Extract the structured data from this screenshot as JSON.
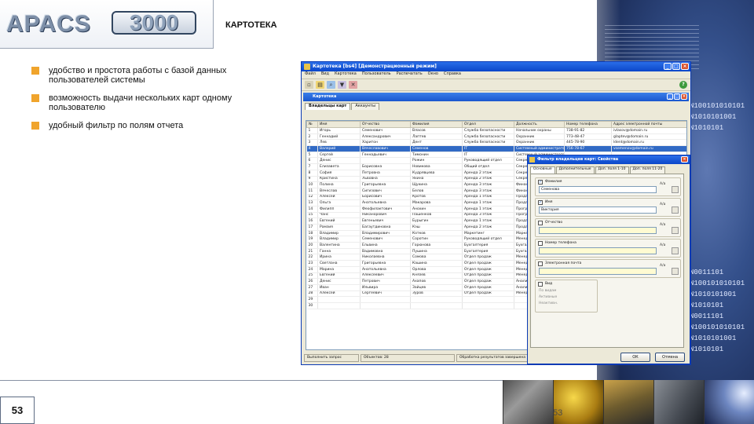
{
  "header": {
    "logo_text": "APACS",
    "logo_number": "3000",
    "page_title": "КАРТОТЕКА"
  },
  "bullets": [
    "удобство и простота работы с базой данных пользователей системы",
    "возможность выдачи нескольких карт одному пользователю",
    "удобный фильтр по полям отчета"
  ],
  "footer": {
    "page_number": "53",
    "page_number_small": "53"
  },
  "decor": {
    "code_top": "N100101010101\nN1010101001\nN1010101",
    "code_bottom": "N0011101\nN100101010101\nN1010101001\nN1010101\nN0011101\nN100101010101\nN1010101001\nN1010101"
  },
  "app": {
    "title": "Картотека [bs4] [Демонстрационный режим]",
    "menu": [
      "Файл",
      "Вид",
      "Картотека",
      "Пользователь",
      "Распечатать",
      "Окно",
      "Справка"
    ],
    "inner_title": "Картотека",
    "tabs": [
      "Владельцы карт",
      "Аккаунты"
    ],
    "columns": [
      "№",
      "Имя",
      "Отчество",
      "Фамилия",
      "Отдел",
      "Должность",
      "Номер телефона",
      "Адрес электронной почты"
    ],
    "rows": [
      [
        "1",
        "Игорь",
        "Семенович",
        "Власов",
        "Служба безопасности",
        "Начальник охраны",
        "738-91-82",
        "ivlasov@domain.ru"
      ],
      [
        "2",
        "Геннадий",
        "Александрович",
        "Лаптев",
        "Служба безопасности",
        "Охранник",
        "773-48-47",
        "glaptev@domain.ru"
      ],
      [
        "3",
        "Лев",
        "Харитон",
        "Дент",
        "Служба безопасности",
        "Охранник",
        "445-78-90",
        "ldent@domain.ru"
      ],
      [
        "4",
        "Валерий",
        "Вячеславович",
        "Семенов",
        "IT",
        "Системный администратор",
        "756-78-67",
        "vsemenov@domain.ru"
      ],
      [
        "5",
        "Сергей",
        "Геннадьевич",
        "Тимонин",
        "IT",
        "Системный администратор",
        "",
        ""
      ],
      [
        "6",
        "Денис",
        "",
        "Рожин",
        "Руководящий отдел",
        "Секретарь",
        "",
        ""
      ],
      [
        "7",
        "Елизавета",
        "Борисовна",
        "Новикова",
        "Общий отдел",
        "Секретарь",
        "",
        ""
      ],
      [
        "8",
        "София",
        "Петровна",
        "Кудрявцева",
        "Аренда 2 этаж",
        "Секретарь",
        "",
        ""
      ],
      [
        "9",
        "Кристина",
        "Львовна",
        "Яхина",
        "Аренда 2 этаж",
        "Секретарь",
        "",
        ""
      ],
      [
        "10",
        "Полина",
        "Григорьевна",
        "Щукина",
        "Аренда 3 этаж",
        "Финансист",
        "",
        ""
      ],
      [
        "11",
        "Вячеслав",
        "Сигизович",
        "Белов",
        "Аренда 3 этаж",
        "Финансист",
        "",
        ""
      ],
      [
        "12",
        "Алексей",
        "Борисович",
        "Кротов",
        "Аренда 1 этаж",
        "Продавец",
        "",
        ""
      ],
      [
        "13",
        "Ольга",
        "Анатольевна",
        "Макарова",
        "Аренда 1 этаж",
        "Продавец",
        "",
        ""
      ],
      [
        "14",
        "Филипп",
        "Феофилактович",
        "Анохин",
        "Аренда 1 этаж",
        "Программист",
        "",
        ""
      ],
      [
        "15",
        "Чанс",
        "Никанорович",
        "Пашенков",
        "Аренда 3 этаж",
        "Программист",
        "",
        ""
      ],
      [
        "16",
        "Евгений",
        "Евгеньевич",
        "Бурыгин",
        "Аренда 1 этаж",
        "Продавец",
        "",
        ""
      ],
      [
        "17",
        "Рамзия",
        "Багаутдиновна",
        "Кэш",
        "Аренда 2 этаж",
        "Продавец",
        "",
        ""
      ],
      [
        "18",
        "Владимир",
        "Владимирович",
        "Котков",
        "Маркетинг",
        "Маркетолог",
        "",
        ""
      ],
      [
        "19",
        "Владимир",
        "Семенович",
        "Соротин",
        "Руководящий отдел",
        "Менеджер",
        "",
        ""
      ],
      [
        "20",
        "Валентина",
        "Ельвина",
        "Горюнова",
        "Бухгалтерия",
        "Бухгалтер",
        "",
        ""
      ],
      [
        "21",
        "Ганна",
        "Вадимовна",
        "Пушина",
        "Бухгалтерия",
        "Бухгалтер",
        "",
        ""
      ],
      [
        "22",
        "Ирина",
        "Николаевна",
        "Сомова",
        "Отдел продаж",
        "Менеджер",
        "",
        ""
      ],
      [
        "23",
        "Светлана",
        "Григорьевна",
        "Кашина",
        "Отдел продаж",
        "Менеджер",
        "",
        ""
      ],
      [
        "24",
        "Марина",
        "Анатольевна",
        "Орлова",
        "Отдел продаж",
        "Менеджер",
        "",
        ""
      ],
      [
        "25",
        "Евгений",
        "Алексеевич",
        "Князев",
        "Отдел продаж",
        "Менеджер",
        "",
        ""
      ],
      [
        "26",
        "Денис",
        "Петрович",
        "Ахапов",
        "Отдел продаж",
        "Аналитик",
        "",
        ""
      ],
      [
        "27",
        "Иван",
        "Ильвира",
        "Зайцев",
        "Отдел продаж",
        "Аналитик",
        "",
        ""
      ],
      [
        "28",
        "Алексей",
        "Сергеевич",
        "Зуров",
        "Отдел продаж",
        "Менеджер",
        "",
        ""
      ],
      [
        "29",
        "",
        "",
        "",
        "",
        "",
        "",
        ""
      ],
      [
        "30",
        "",
        "",
        "",
        "",
        "",
        "",
        ""
      ]
    ],
    "status": [
      "Выполнить запрос",
      "Объектов: 28",
      "Обработка результатов завершена"
    ]
  },
  "dialog": {
    "title": "Фильтр владельцев карт: Свойства",
    "tabs": [
      "Основные",
      "Дополнительные",
      "Доп. поля 1-10",
      "Доп. поля 11-20"
    ],
    "fields": [
      {
        "label": "Фамилия",
        "value": "Семенова",
        "checked": true
      },
      {
        "label": "Имя",
        "value": "Виктория",
        "checked": true
      },
      {
        "label": "Отчество",
        "value": "",
        "checked": false
      },
      {
        "label": "Номер телефона",
        "value": "",
        "checked": false
      },
      {
        "label": "Электронная почта",
        "value": "",
        "checked": false
      }
    ],
    "ops_label": "А/а",
    "card_group_label": "Вид",
    "card_group_items": [
      "По видам",
      "Активные",
      "Неактивн."
    ],
    "ok": "ОК",
    "cancel": "Отмена"
  }
}
